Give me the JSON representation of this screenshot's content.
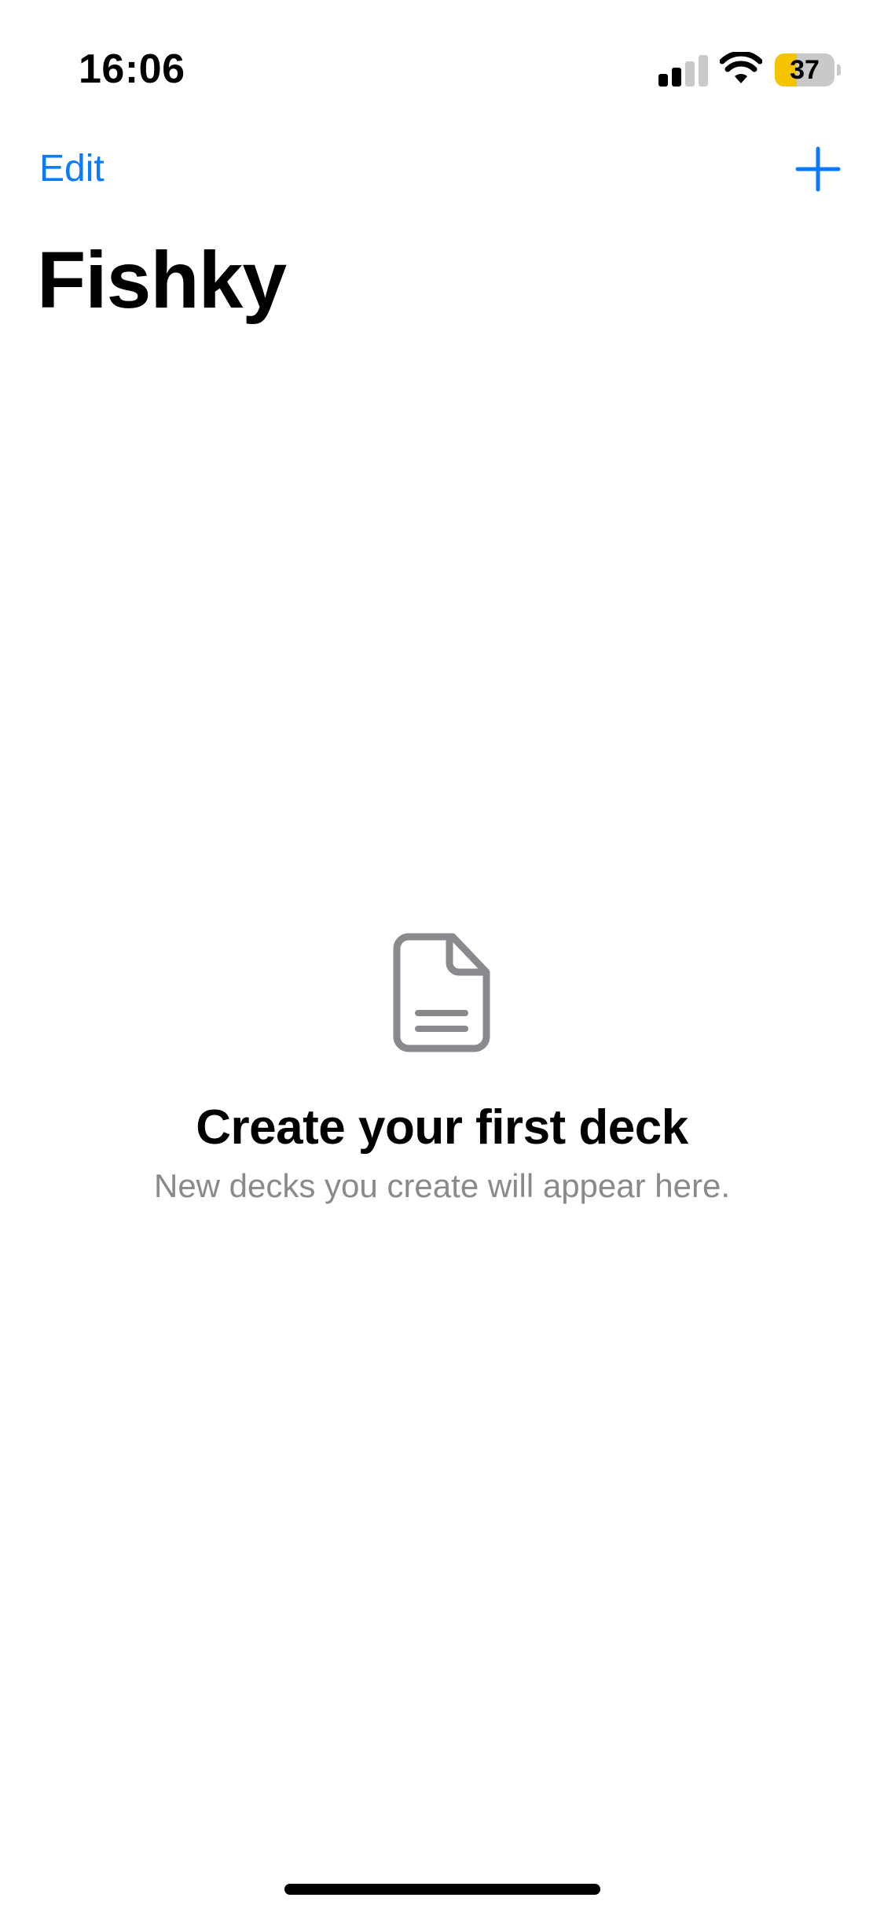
{
  "status_bar": {
    "time": "16:06",
    "signal_bars_active": 2,
    "signal_bars_total": 4,
    "battery_level": 37,
    "battery_text": "37",
    "battery_color": "#f5c400",
    "icons": [
      "cellular-signal-icon",
      "wifi-icon",
      "battery-icon"
    ]
  },
  "nav": {
    "edit_label": "Edit",
    "add_icon": "plus-icon",
    "title": "Fishky",
    "accent_color": "#0a7aff"
  },
  "empty_state": {
    "icon": "document-icon",
    "icon_color": "#8a8a8e",
    "title": "Create your first deck",
    "subtitle": "New decks you create will appear here."
  }
}
